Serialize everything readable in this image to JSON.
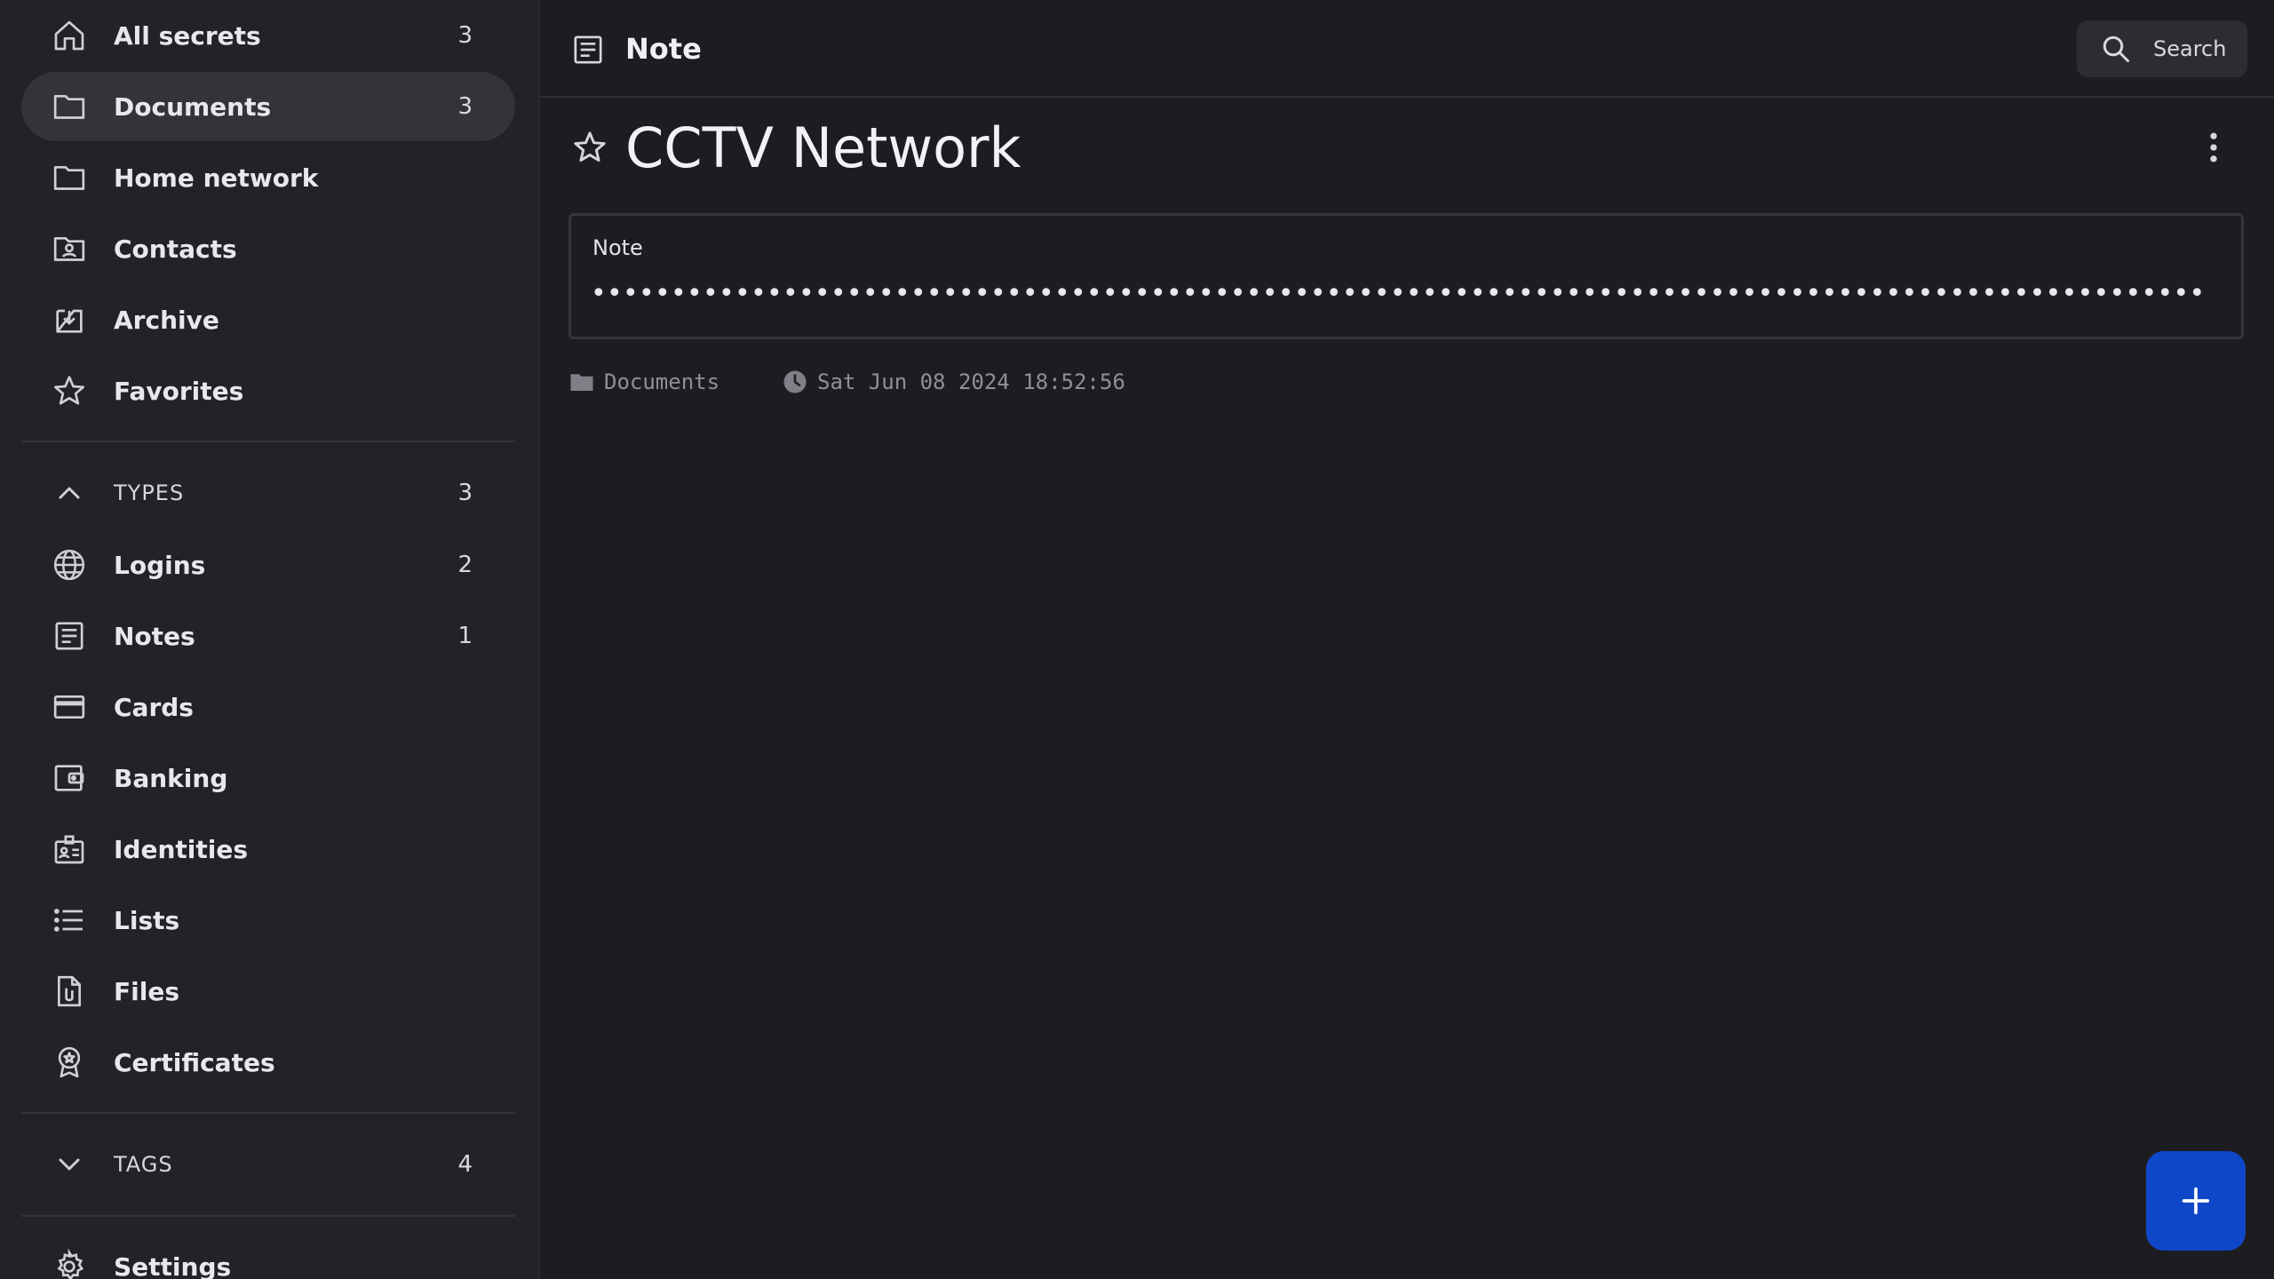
{
  "sidebar": {
    "items": [
      {
        "label": "All secrets",
        "count": "3",
        "icon": "home-icon"
      },
      {
        "label": "Documents",
        "count": "3",
        "icon": "folder-icon"
      },
      {
        "label": "Home network",
        "count": "",
        "icon": "folder-icon"
      },
      {
        "label": "Contacts",
        "count": "",
        "icon": "contacts-folder-icon"
      },
      {
        "label": "Archive",
        "count": "",
        "icon": "archive-icon"
      },
      {
        "label": "Favorites",
        "count": "",
        "icon": "star-icon"
      }
    ],
    "types_section": {
      "label": "TYPES",
      "count": "3"
    },
    "types": [
      {
        "label": "Logins",
        "count": "2",
        "icon": "globe-icon"
      },
      {
        "label": "Notes",
        "count": "1",
        "icon": "note-icon"
      },
      {
        "label": "Cards",
        "count": "",
        "icon": "credit-card-icon"
      },
      {
        "label": "Banking",
        "count": "",
        "icon": "wallet-icon"
      },
      {
        "label": "Identities",
        "count": "",
        "icon": "id-badge-icon"
      },
      {
        "label": "Lists",
        "count": "",
        "icon": "list-icon"
      },
      {
        "label": "Files",
        "count": "",
        "icon": "file-attachment-icon"
      },
      {
        "label": "Certificates",
        "count": "",
        "icon": "certificate-icon"
      }
    ],
    "tags_section": {
      "label": "TAGS",
      "count": "4"
    },
    "settings": {
      "label": "Settings",
      "icon": "gear-icon"
    }
  },
  "header": {
    "title": "Note",
    "search_label": "Search"
  },
  "item": {
    "title": "CCTV Network",
    "note_label": "Note",
    "note_value": "•••••••••••••••••••••••••••••••••••••••••••••••••••••••••••••••••••••••••••••••••••••••••••••••••••••",
    "folder": "Documents",
    "timestamp": "Sat Jun 08 2024 18:52:56"
  },
  "colors": {
    "background": "#1d1d21",
    "sidebar": "#222227",
    "active_item": "#33343a",
    "fab": "#0f47c9",
    "muted_text": "#8f8f98"
  }
}
